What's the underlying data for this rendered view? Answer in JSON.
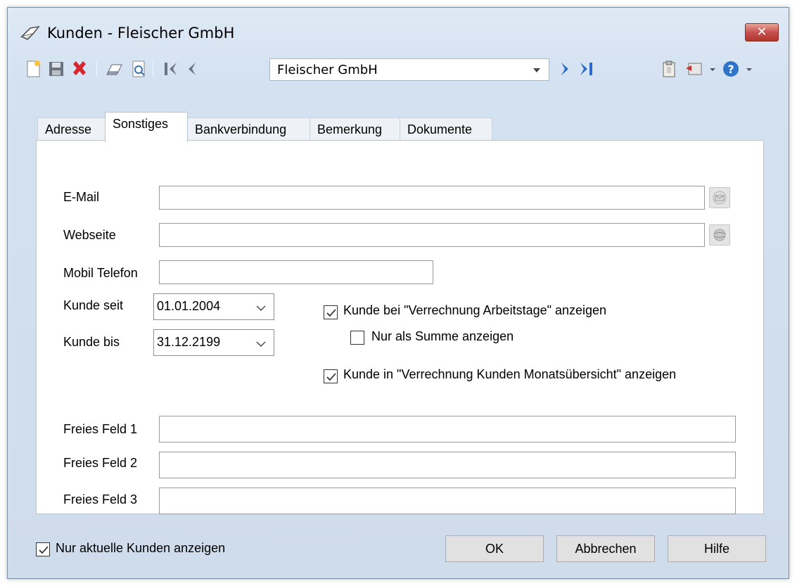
{
  "window": {
    "title": "Kunden - Fleischer GmbH",
    "close_label": "✕"
  },
  "toolbar": {
    "record_combo_value": "Fleischer GmbH",
    "icons": [
      "new-icon",
      "save-icon",
      "delete-icon",
      "print-icon",
      "preview-icon",
      "first-record-icon",
      "previous-record-icon",
      "next-record-icon",
      "last-record-icon",
      "clipboard-icon",
      "export-icon",
      "help-icon"
    ]
  },
  "tabs": [
    {
      "label": "Adresse"
    },
    {
      "label": "Sonstiges"
    },
    {
      "label": "Bankverbindung"
    },
    {
      "label": "Bemerkung"
    },
    {
      "label": "Dokumente"
    }
  ],
  "form": {
    "email_label": "E-Mail",
    "email_value": "",
    "website_label": "Webseite",
    "website_value": "",
    "mobile_label": "Mobil Telefon",
    "mobile_value": "",
    "customer_since_label": "Kunde seit",
    "customer_since_value": "01.01.2004",
    "customer_until_label": "Kunde bis",
    "customer_until_value": "31.12.2199",
    "cb_workdays_label": "Kunde bei \"Verrechnung Arbeitstage\" anzeigen",
    "cb_workdays_checked": true,
    "cb_sum_only_label": "Nur als Summe anzeigen",
    "cb_sum_only_checked": false,
    "cb_monthly_label": "Kunde in \"Verrechnung Kunden Monatsübersicht\" anzeigen",
    "cb_monthly_checked": true,
    "free1_label": "Freies Feld 1",
    "free1_value": "",
    "free2_label": "Freies Feld 2",
    "free2_value": "",
    "free3_label": "Freies Feld 3",
    "free3_value": ""
  },
  "footer": {
    "cb_current_only_label": "Nur aktuelle Kunden anzeigen",
    "cb_current_only_checked": true,
    "ok_label": "OK",
    "cancel_label": "Abbrechen",
    "help_label": "Hilfe"
  },
  "colors": {
    "window_bg": "#d3e1f1",
    "close_button": "#c75050",
    "panel_bg": "#ffffff"
  }
}
